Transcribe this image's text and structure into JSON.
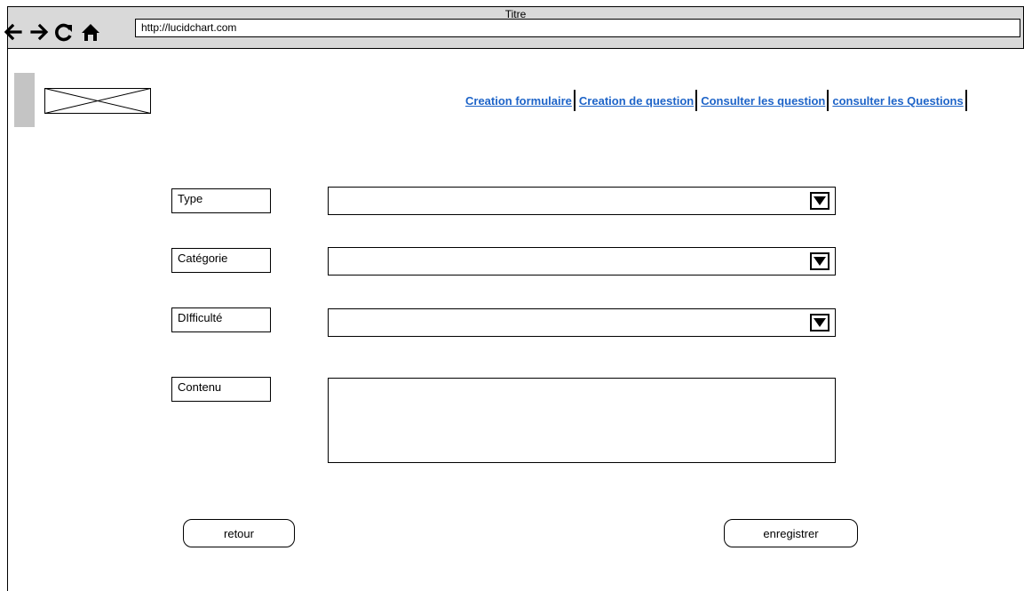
{
  "window": {
    "title": "Titre",
    "url": "http://lucidchart.com",
    "nav_icons": [
      "back-arrow-icon",
      "forward-arrow-icon",
      "reload-icon",
      "home-icon"
    ]
  },
  "header": {
    "logo_icon": "image-placeholder-icon",
    "nav_links": [
      "Creation formulaire",
      "Creation de question",
      "Consulter les question",
      "consulter les Questions"
    ],
    "link_color": "#1e64c8"
  },
  "form": {
    "type_label": "Type",
    "categorie_label": "Catégorie",
    "difficulte_label": "DIfficulté",
    "contenu_label": "Contenu",
    "type_value": "",
    "categorie_value": "",
    "difficulte_value": "",
    "contenu_value": ""
  },
  "buttons": {
    "back_label": "retour",
    "save_label": "enregistrer"
  }
}
